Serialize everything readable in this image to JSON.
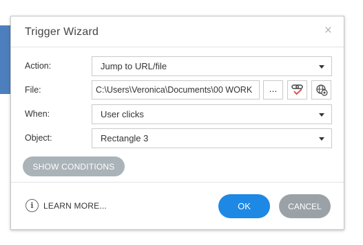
{
  "dialog": {
    "title": "Trigger Wizard",
    "close_glyph": "×",
    "close_icon": "close-icon"
  },
  "form": {
    "action": {
      "label": "Action:",
      "value": "Jump to URL/file"
    },
    "file": {
      "label": "File:",
      "value": "C:\\Users\\Veronica\\Documents\\00 WORK",
      "browse_label": "...",
      "link_icon": "link-check-icon",
      "web_icon": "globe-settings-icon"
    },
    "when": {
      "label": "When:",
      "value": "User clicks"
    },
    "object": {
      "label": "Object:",
      "value": "Rectangle 3"
    }
  },
  "show_conditions_label": "SHOW CONDITIONS",
  "footer": {
    "info_glyph": "i",
    "learn_more": "LEARN MORE...",
    "ok": "OK",
    "cancel": "CANCEL"
  },
  "colors": {
    "ok_button": "#1e88e5",
    "cancel_button": "#9aa2a7",
    "show_conditions": "#aab3b8",
    "link_check": "#d9534f",
    "background_accent": "#4d7fbf"
  }
}
